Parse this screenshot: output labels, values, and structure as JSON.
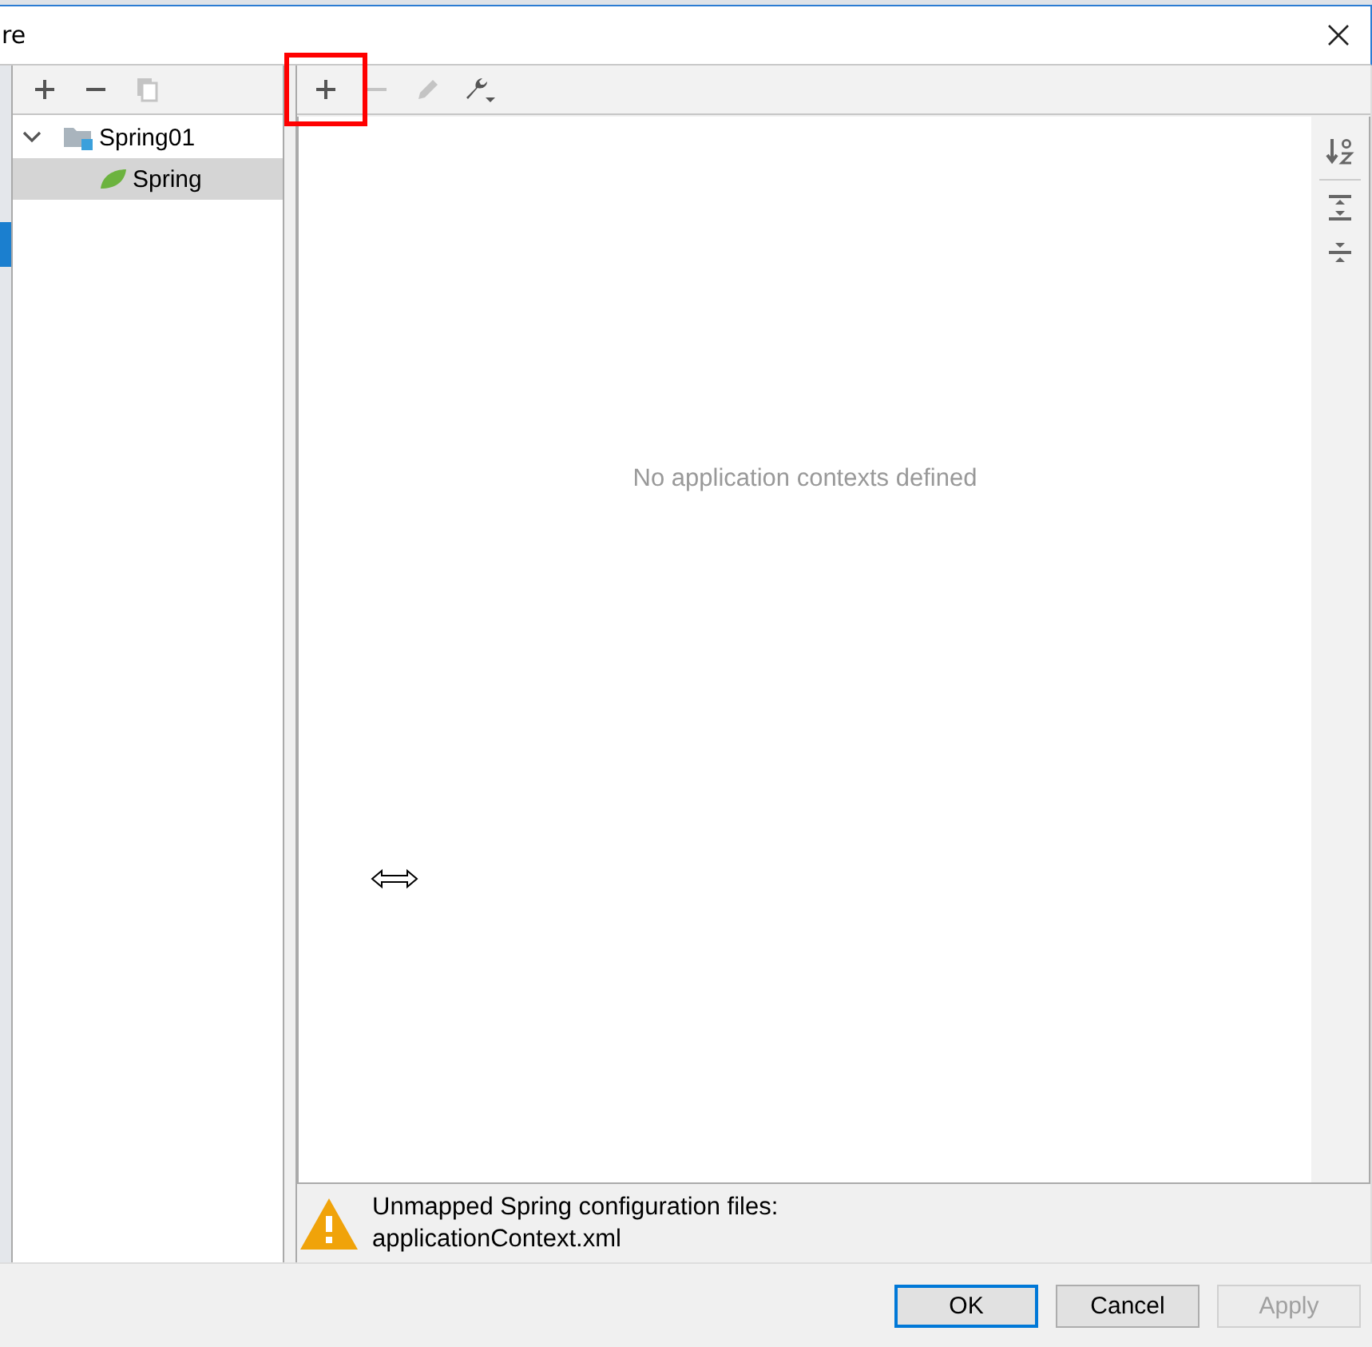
{
  "window": {
    "title": "re"
  },
  "left_toolbar": [
    {
      "kind": "add",
      "disabled": false
    },
    {
      "kind": "remove",
      "disabled": false
    },
    {
      "kind": "copy",
      "disabled": true
    }
  ],
  "tree": [
    {
      "label": "Spring01",
      "kind": "module",
      "expanded": true,
      "selected": false,
      "children": [
        {
          "label": "Spring",
          "kind": "facet",
          "selected": true
        }
      ]
    }
  ],
  "right_toolbar": [
    {
      "kind": "add",
      "disabled": false,
      "highlighted": true
    },
    {
      "kind": "remove",
      "disabled": true,
      "highlighted": false
    },
    {
      "kind": "edit",
      "disabled": true,
      "highlighted": false
    },
    {
      "kind": "wrench",
      "disabled": false,
      "highlighted": false
    }
  ],
  "empty_message": "No application contexts defined",
  "side_tools": [
    {
      "kind": "sort"
    },
    {
      "kind": "expand"
    },
    {
      "kind": "collapse"
    }
  ],
  "warning": {
    "line_1": "Unmapped Spring configuration files:",
    "line_2": "applicationContext.xml"
  },
  "buttons": [
    {
      "label": "OK",
      "default": true,
      "disabled": false
    },
    {
      "label": "Cancel",
      "default": false,
      "disabled": false
    },
    {
      "label": "Apply",
      "default": false,
      "disabled": true
    }
  ]
}
